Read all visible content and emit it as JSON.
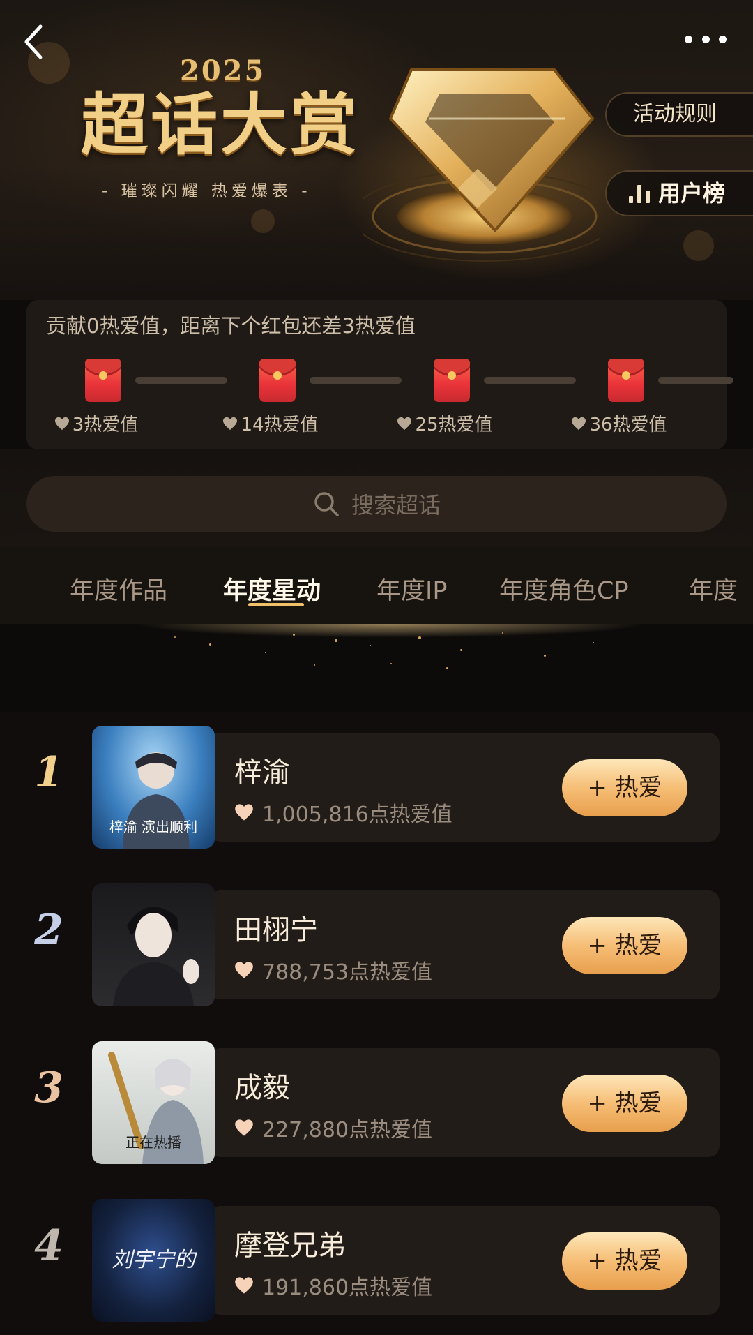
{
  "header": {
    "year": "2025",
    "title": "超话大赏",
    "tagline": "- 璀璨闪耀  热爱爆表 -",
    "rules_label": "活动规则",
    "user_rank_label": "用户榜"
  },
  "progress": {
    "text": "贡献0热爱值，距离下个红包还差3热爱值",
    "milestones": [
      {
        "label": "3热爱值"
      },
      {
        "label": "14热爱值"
      },
      {
        "label": "25热爱值"
      },
      {
        "label": "36热爱值"
      }
    ]
  },
  "search": {
    "placeholder": "搜索超话"
  },
  "tabs": [
    {
      "label": "年度作品"
    },
    {
      "label": "年度星动",
      "active": true
    },
    {
      "label": "年度IP"
    },
    {
      "label": "年度角色CP"
    },
    {
      "label": "年度"
    }
  ],
  "ranking": [
    {
      "rank": "1",
      "name": "梓渝",
      "score": "1,005,816点热爱值",
      "button": "+ 热爱",
      "thumb_caption": "梓渝 演出顺利"
    },
    {
      "rank": "2",
      "name": "田栩宁",
      "score": "788,753点热爱值",
      "button": "+ 热爱",
      "thumb_caption": ""
    },
    {
      "rank": "3",
      "name": "成毅",
      "score": "227,880点热爱值",
      "button": "+ 热爱",
      "thumb_caption": "正在热播"
    },
    {
      "rank": "4",
      "name": "摩登兄弟",
      "score": "191,860点热爱值",
      "button": "+ 热爱",
      "thumb_caption": "刘宇宁的"
    }
  ],
  "colors": {
    "accent_gold": "#f0c169",
    "button_gradient_top": "#fde7b9",
    "button_gradient_bottom": "#e79f4d",
    "red_packet": "#e9333a",
    "background": "#0e0c0b"
  },
  "icons": {
    "back": "chevron-left-icon",
    "more": "more-dots-icon",
    "chart": "bar-chart-icon",
    "search": "search-icon",
    "heart": "heart-icon",
    "red_packet": "red-packet-icon"
  }
}
